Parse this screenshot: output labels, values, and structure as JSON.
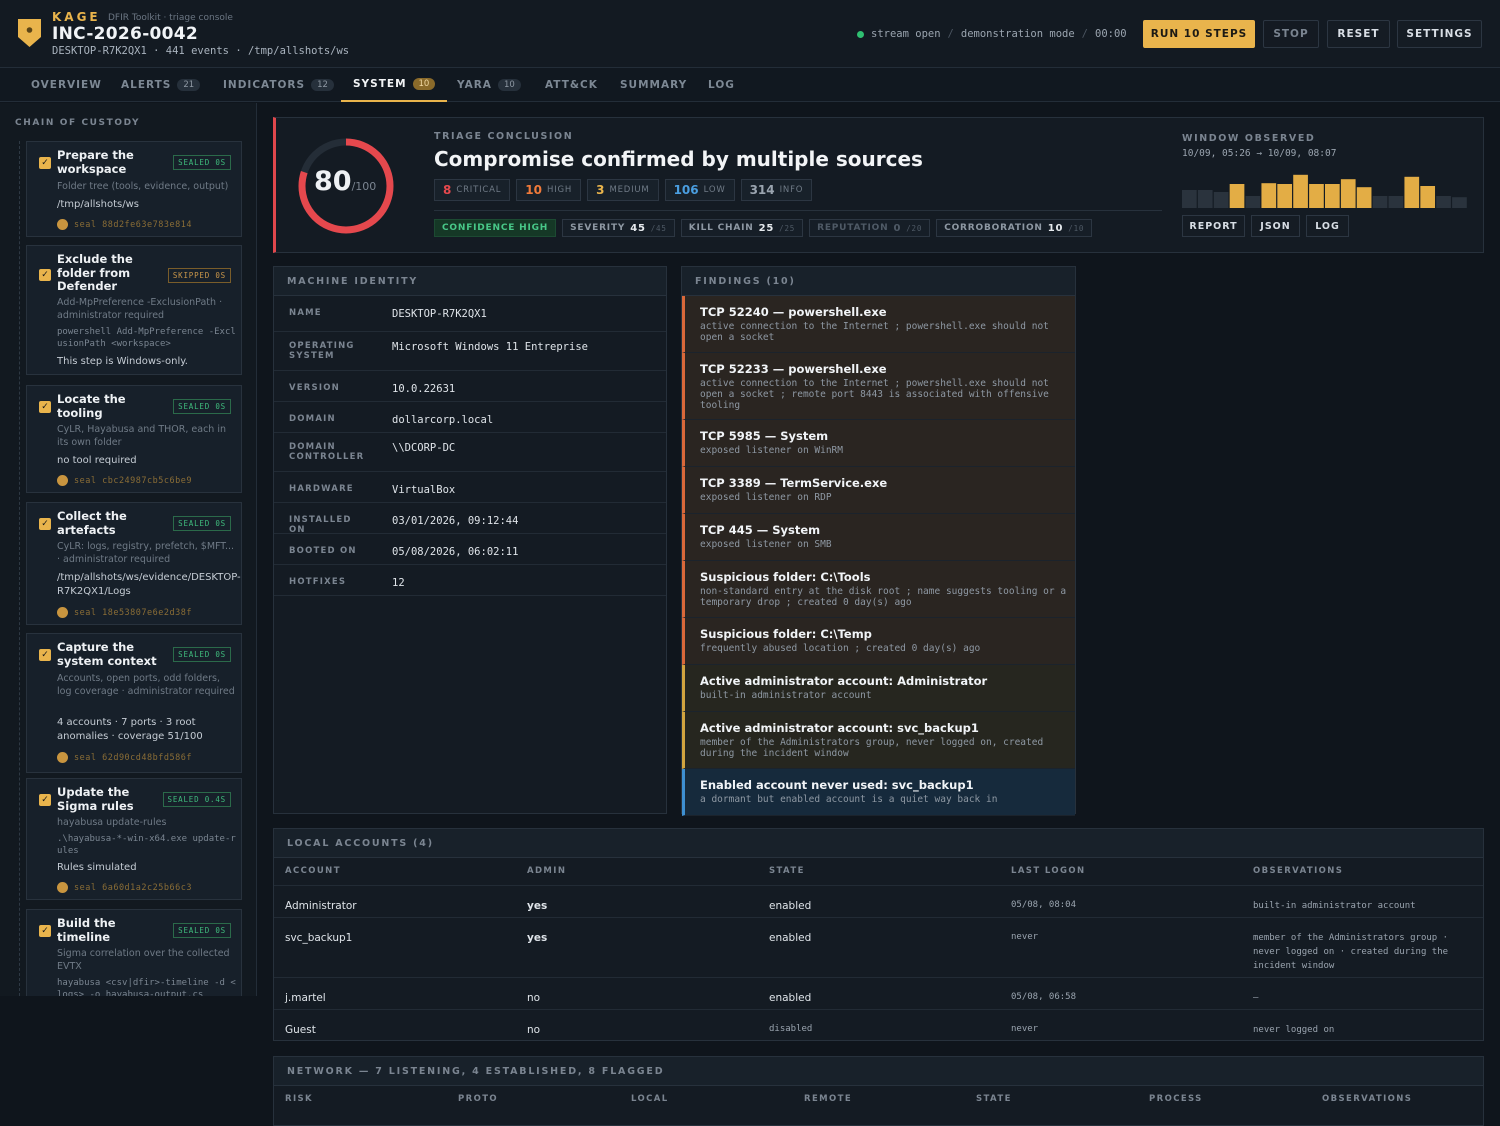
{
  "header": {
    "brand": "KAGE",
    "tagline": "DFIR Toolkit · triage console",
    "incident_id": "INC-2026-0042",
    "subline": "DESKTOP-R7K2QX1 · 441 events · /tmp/allshots/ws",
    "status": {
      "stream": "stream open",
      "mode": "demonstration mode",
      "time": "00:00"
    },
    "buttons": {
      "run": "RUN 10 STEPS",
      "stop": "STOP",
      "reset": "RESET",
      "settings": "SETTINGS"
    }
  },
  "tabs": [
    {
      "label": "OVERVIEW",
      "count": ""
    },
    {
      "label": "ALERTS",
      "count": "21"
    },
    {
      "label": "INDICATORS",
      "count": "12"
    },
    {
      "label": "SYSTEM",
      "count": "10"
    },
    {
      "label": "YARA",
      "count": "10"
    },
    {
      "label": "ATT&CK",
      "count": ""
    },
    {
      "label": "SUMMARY",
      "count": ""
    },
    {
      "label": "LOG",
      "count": ""
    }
  ],
  "sidebar": {
    "title": "CHAIN OF CUSTODY",
    "steps": [
      {
        "title": "Prepare the workspace",
        "badge": "SEALED 0S",
        "desc": "Folder tree (tools, evidence, output)",
        "cmd": "",
        "result": "/tmp/allshots/ws",
        "seal": "seal 88d2fe63e783e814"
      },
      {
        "title": "Exclude the folder from Defender",
        "badge": "SKIPPED 0S",
        "desc": "Add-MpPreference -ExclusionPath · administrator required",
        "cmd": "powershell Add-MpPreference -ExclusionPath <workspace>",
        "result": "This step is Windows-only.",
        "seal": ""
      },
      {
        "title": "Locate the tooling",
        "badge": "SEALED 0S",
        "desc": "CyLR, Hayabusa and THOR, each in its own folder",
        "cmd": "",
        "result": "no tool required",
        "seal": "seal cbc24987cb5c6be9"
      },
      {
        "title": "Collect the artefacts",
        "badge": "SEALED 0S",
        "desc": "CyLR: logs, registry, prefetch, $MFT... · administrator required",
        "cmd": "",
        "result": "/tmp/allshots/ws/evidence/DESKTOP-R7K2QX1/Logs",
        "seal": "seal 18e53807e6e2d38f"
      },
      {
        "title": "Capture the system context",
        "badge": "SEALED 0S",
        "desc": "Accounts, open ports, odd folders, log coverage · administrator required",
        "cmd": "",
        "result": "4 accounts · 7 ports · 3 root anomalies · coverage 51/100",
        "seal": "seal 62d90cd48bfd586f"
      },
      {
        "title": "Update the Sigma rules",
        "badge": "SEALED 0.4S",
        "desc": "hayabusa update-rules",
        "cmd": ".\\hayabusa-*-win-x64.exe update-rules",
        "result": "Rules simulated",
        "seal": "seal 6a60d1a2c25b66c3"
      },
      {
        "title": "Build the timeline",
        "badge": "SEALED 0S",
        "desc": "Sigma correlation over the collected EVTX",
        "cmd": "hayabusa <csv|dfir>-timeline -d <logs> -o hayabusa-output.cs",
        "result": "",
        "seal": ""
      }
    ]
  },
  "summary": {
    "score": "80",
    "score_max": "/100",
    "label": "TRIAGE CONCLUSION",
    "title": "Compromise confirmed by multiple sources",
    "severities": [
      {
        "count": "8",
        "label": "CRITICAL",
        "color": "#e5484d"
      },
      {
        "count": "10",
        "label": "HIGH",
        "color": "#f07a3a"
      },
      {
        "count": "3",
        "label": "MEDIUM",
        "color": "#e9b44c"
      },
      {
        "count": "106",
        "label": "LOW",
        "color": "#4a9ee0"
      },
      {
        "count": "314",
        "label": "INFO",
        "color": "#9aa4af"
      }
    ],
    "confidence": "CONFIDENCE HIGH",
    "scores": [
      {
        "label": "SEVERITY",
        "value": "45",
        "max": "/45"
      },
      {
        "label": "KILL CHAIN",
        "value": "25",
        "max": "/25"
      },
      {
        "label": "REPUTATION",
        "value": "0",
        "max": "/20"
      },
      {
        "label": "CORROBORATION",
        "value": "10",
        "max": "/10"
      }
    ],
    "window_label": "WINDOW OBSERVED",
    "window_range": "10/09, 05:26 → 10/09, 08:07",
    "histogram": [
      0.45,
      0.45,
      0.4,
      0.6,
      0.3,
      0.62,
      0.6,
      0.83,
      0.6,
      0.6,
      0.72,
      0.52,
      0.3,
      0.3,
      0.78,
      0.55,
      0.3,
      0.27
    ],
    "histogram_active": [
      false,
      false,
      false,
      true,
      false,
      true,
      true,
      true,
      true,
      true,
      true,
      true,
      false,
      false,
      true,
      true,
      false,
      false
    ],
    "actions": {
      "report": "REPORT",
      "json": "JSON",
      "log": "LOG"
    }
  },
  "identity": {
    "title": "MACHINE IDENTITY",
    "rows": [
      {
        "key": "NAME",
        "value": "DESKTOP-R7K2QX1"
      },
      {
        "key": "OPERATING SYSTEM",
        "value": "Microsoft Windows 11 Entreprise"
      },
      {
        "key": "VERSION",
        "value": "10.0.22631"
      },
      {
        "key": "DOMAIN",
        "value": "dollarcorp.local"
      },
      {
        "key": "DOMAIN CONTROLLER",
        "value": "\\\\DCORP-DC"
      },
      {
        "key": "HARDWARE",
        "value": "VirtualBox"
      },
      {
        "key": "INSTALLED ON",
        "value": "03/01/2026, 09:12:44"
      },
      {
        "key": "BOOTED ON",
        "value": "05/08/2026, 06:02:11"
      },
      {
        "key": "HOTFIXES",
        "value": "12"
      }
    ]
  },
  "findings": {
    "title": "FINDINGS (10)",
    "items": [
      {
        "title": "TCP 52240 — powershell.exe",
        "desc": "active connection to the Internet ; powershell.exe should not open a socket",
        "level": "high"
      },
      {
        "title": "TCP 52233 — powershell.exe",
        "desc": "active connection to the Internet ; powershell.exe should not open a socket ; remote port 8443 is associated with offensive tooling",
        "level": "high"
      },
      {
        "title": "TCP 5985 — System",
        "desc": "exposed listener on WinRM",
        "level": "high"
      },
      {
        "title": "TCP 3389 — TermService.exe",
        "desc": "exposed listener on RDP",
        "level": "high"
      },
      {
        "title": "TCP 445 — System",
        "desc": "exposed listener on SMB",
        "level": "high"
      },
      {
        "title": "Suspicious folder: C:\\Tools",
        "desc": "non-standard entry at the disk root ; name suggests tooling or a temporary drop ; created 0 day(s) ago",
        "level": "high"
      },
      {
        "title": "Suspicious folder: C:\\Temp",
        "desc": "frequently abused location ; created 0 day(s) ago",
        "level": "high"
      },
      {
        "title": "Active administrator account: Administrator",
        "desc": "built-in administrator account",
        "level": "medium"
      },
      {
        "title": "Active administrator account: svc_backup1",
        "desc": "member of the Administrators group, never logged on, created during the incident window",
        "level": "medium"
      },
      {
        "title": "Enabled account never used: svc_backup1",
        "desc": "a dormant but enabled account is a quiet way back in",
        "level": "low"
      }
    ]
  },
  "accounts": {
    "title": "LOCAL ACCOUNTS (4)",
    "headers": [
      "ACCOUNT",
      "ADMIN",
      "STATE",
      "LAST LOGON",
      "OBSERVATIONS"
    ],
    "rows": [
      {
        "account": "Administrator",
        "admin": "yes",
        "state": "enabled",
        "last": "05/08, 08:04",
        "obs": "built-in administrator account"
      },
      {
        "account": "svc_backup1",
        "admin": "yes",
        "state": "enabled",
        "last": "never",
        "obs": "member of the Administrators group · never logged on · created during the incident window"
      },
      {
        "account": "j.martel",
        "admin": "no",
        "state": "enabled",
        "last": "05/08, 06:58",
        "obs": "—"
      },
      {
        "account": "Guest",
        "admin": "no",
        "state": "disabled",
        "last": "never",
        "obs": "never logged on"
      }
    ]
  },
  "network": {
    "title": "NETWORK — 7 LISTENING, 4 ESTABLISHED, 8 FLAGGED",
    "headers": [
      "RISK",
      "PROTO",
      "LOCAL",
      "REMOTE",
      "STATE",
      "PROCESS",
      "OBSERVATIONS"
    ]
  },
  "colors": {
    "accent": "#e9b44c",
    "critical": "#e5484d",
    "ok": "#2fbf71"
  }
}
